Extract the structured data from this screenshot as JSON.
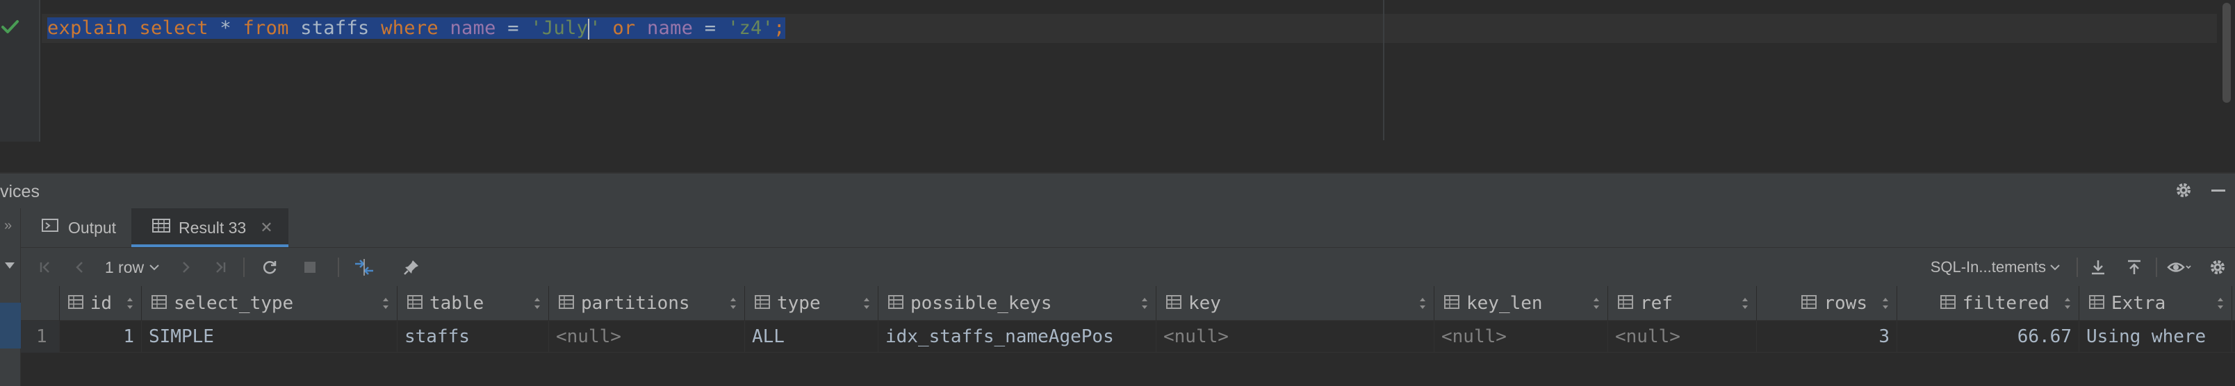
{
  "editor": {
    "tokens": [
      {
        "text": "explain",
        "cls": "kw"
      },
      {
        "text": " ",
        "cls": "id"
      },
      {
        "text": "select",
        "cls": "kw"
      },
      {
        "text": " * ",
        "cls": "id"
      },
      {
        "text": "from",
        "cls": "kw"
      },
      {
        "text": " staffs ",
        "cls": "id"
      },
      {
        "text": "where",
        "cls": "kw"
      },
      {
        "text": " ",
        "cls": "id"
      },
      {
        "text": "name",
        "cls": "col"
      },
      {
        "text": " = ",
        "cls": "id"
      },
      {
        "text": "'July'",
        "cls": "str"
      },
      {
        "text": " ",
        "cls": "id"
      },
      {
        "text": "or",
        "cls": "kw"
      },
      {
        "text": " ",
        "cls": "id"
      },
      {
        "text": "name",
        "cls": "col"
      },
      {
        "text": " = ",
        "cls": "id"
      },
      {
        "text": "'z4'",
        "cls": "str"
      },
      {
        "text": ";",
        "cls": "kw"
      }
    ],
    "status_icon": "check-icon"
  },
  "tool_window": {
    "title": "vices"
  },
  "tabs": [
    {
      "label": "Output",
      "icon": "output-icon",
      "active": false
    },
    {
      "label": "Result 33",
      "icon": "table-icon",
      "active": true
    }
  ],
  "toolbar": {
    "rows_label": "1 row",
    "mode_label": "SQL-In...tements"
  },
  "grid": {
    "columns": [
      {
        "name": "id",
        "numeric": true
      },
      {
        "name": "select_type",
        "numeric": false
      },
      {
        "name": "table",
        "numeric": false
      },
      {
        "name": "partitions",
        "numeric": false
      },
      {
        "name": "type",
        "numeric": false
      },
      {
        "name": "possible_keys",
        "numeric": false
      },
      {
        "name": "key",
        "numeric": false
      },
      {
        "name": "key_len",
        "numeric": false
      },
      {
        "name": "ref",
        "numeric": false
      },
      {
        "name": "rows",
        "numeric": true
      },
      {
        "name": "filtered",
        "numeric": true
      },
      {
        "name": "Extra",
        "numeric": false
      }
    ],
    "rows": [
      {
        "row_number": "1",
        "cells": [
          "1",
          "SIMPLE",
          "staffs",
          "<null>",
          "ALL",
          "idx_staffs_nameAgePos",
          "<null>",
          "<null>",
          "<null>",
          "3",
          "66.67",
          "Using where"
        ]
      }
    ]
  },
  "colors": {
    "selection": "#214283",
    "keyword": "#cc7832",
    "string": "#6a8759",
    "column": "#9876aa",
    "accent": "#4a88c7",
    "ok": "#499c54"
  }
}
